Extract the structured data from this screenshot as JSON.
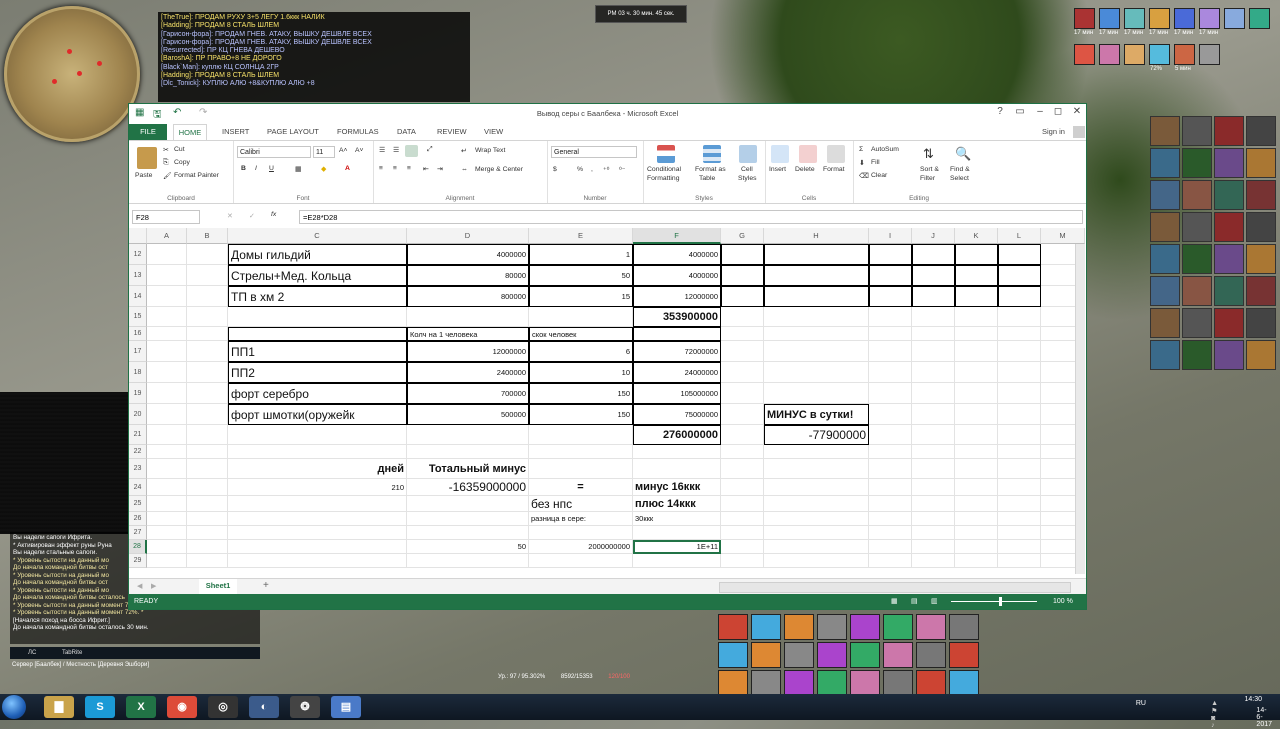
{
  "game": {
    "chat_top": [
      {
        "text": "[TheTrue]: ПРОДАМ РУХУ 3+5 ЛЕГУ 1.6ккк НАЛИК",
        "hl": true
      },
      {
        "text": "[Hadding]: ПРОДАМ 8 СТАЛЬ ШЛЕМ",
        "hl": true
      },
      {
        "text": "[Гарисон-фора]: ПРОДАМ ГНЕВ. АТАКУ, ВЫШКУ ДЕШВЛЕ ВСЕХ",
        "hl": false
      },
      {
        "text": "[Гарисон-фора]: ПРОДАМ ГНЕВ. АТАКУ, ВЫШКУ ДЕШВЛЕ ВСЕХ",
        "hl": false
      },
      {
        "text": "[Resurrected]: ПР КЦ ГНЕВА ДЕШЕВО",
        "hl": false
      },
      {
        "text": "[BaroshA]: ПР ПРАВО+8 НЕ ДОРОГО",
        "hl": true
      },
      {
        "text": "[Black`Man]: куплю КЦ СОЛНЦА 2ГР",
        "hl": false
      },
      {
        "text": "[Hadding]: ПРОДАМ 8 СТАЛЬ ШЛЕМ",
        "hl": true
      },
      {
        "text": "[Dlc_Tonick]: КУПЛЮ АЛЮ +8&КУПЛЮ АЛЮ +8",
        "hl": false
      }
    ],
    "timer": "PM 03 ч. 30 мин. 45 сек.",
    "buff_times": [
      "17 мин",
      "17 мин",
      "17 мин",
      "17 мин",
      "17 мин",
      "17 мин",
      "72%",
      "5 мин"
    ],
    "chat_bottom": [
      {
        "text": "Вы надели сапоги Ифрита.",
        "w": true
      },
      {
        "text": "  * Активирован эффект руны Руна",
        "w": true
      },
      {
        "text": "Вы надели стальные сапоги.",
        "w": true
      },
      {
        "text": "  * Уровень сытости на данный мо",
        "w": false
      },
      {
        "text": "До начала командной битвы ост",
        "w": false
      },
      {
        "text": "  * Уровень сытости на данный мо",
        "w": false
      },
      {
        "text": "До начала командной битвы ост",
        "w": false
      },
      {
        "text": "  * Уровень сытости на данный мо",
        "w": false
      },
      {
        "text": "До начала командной битвы осталось",
        "w": false
      },
      {
        "text": "  * Уровень сытости на данный момент 72%. *",
        "w": false
      },
      {
        "text": "  * Уровень сытости на данный момент 72%. *",
        "w": false
      },
      {
        "text": "[Начался поход на босса Ифрит.]",
        "w": true
      },
      {
        "text": "До начала командной битвы осталось 30 мин.",
        "w": true
      }
    ],
    "chat_tabs": [
      "ЛС",
      "TabRite"
    ],
    "server_line": "Сервер [Баалбек] / Местность [Деревня Эшбори]",
    "xp_text": "Ур.: 97 / 95.302%",
    "xp_text2": "8592/15353",
    "hp_text": "120/100"
  },
  "excel": {
    "title": "Вывод серы с Баалбека - Microsoft Excel",
    "sign_in": "Sign in",
    "window_controls": [
      "?",
      "▭",
      "–",
      "◻",
      "✕"
    ],
    "tabs": [
      "FILE",
      "HOME",
      "INSERT",
      "PAGE LAYOUT",
      "FORMULAS",
      "DATA",
      "REVIEW",
      "VIEW"
    ],
    "ribbon": {
      "paste": "Paste",
      "cut": "Cut",
      "copy": "Copy",
      "format_painter": "Format Painter",
      "clipboard": "Clipboard",
      "font_name": "Calibri",
      "font_size": "11",
      "font": "Font",
      "bold": "B",
      "italic": "I",
      "underline": "U",
      "wrap_text": "Wrap Text",
      "merge_center": "Merge & Center",
      "alignment": "Alignment",
      "number_format": "General",
      "percent": "%",
      "comma": ",",
      "number": "Number",
      "conditional": "Conditional",
      "formatting": "Formatting",
      "format_as": "Format as",
      "table": "Table",
      "cell": "Cell",
      "styles_btn": "Styles",
      "styles": "Styles",
      "insert": "Insert",
      "delete": "Delete",
      "format": "Format",
      "cells": "Cells",
      "autosum": "AutoSum",
      "fill": "Fill",
      "clear": "Clear",
      "sort_filter": "Sort &",
      "filter": "Filter",
      "find_select": "Find &",
      "select": "Select",
      "editing": "Editing"
    },
    "name_box": "F28",
    "formula": "=E28*D28",
    "columns": [
      "A",
      "B",
      "C",
      "D",
      "E",
      "F",
      "G",
      "H",
      "I",
      "J",
      "K",
      "L",
      "M"
    ],
    "rows": [
      {
        "n": "12",
        "cells": {
          "C": "Домы гильдий",
          "D": "4000000",
          "E": "1",
          "F": "4000000"
        }
      },
      {
        "n": "13",
        "cells": {
          "C": "Стрелы+Мед. Кольца",
          "D": "80000",
          "E": "50",
          "F": "4000000"
        }
      },
      {
        "n": "14",
        "cells": {
          "C": "ТП в хм 2",
          "D": "800000",
          "E": "15",
          "F": "12000000"
        }
      },
      {
        "n": "15",
        "cells": {
          "F": "353900000"
        }
      },
      {
        "n": "16",
        "cells": {
          "D": "Колч на 1 человека",
          "E": "скок человек"
        }
      },
      {
        "n": "17",
        "cells": {
          "C": "ПП1",
          "D": "12000000",
          "E": "6",
          "F": "72000000"
        }
      },
      {
        "n": "18",
        "cells": {
          "C": "ПП2",
          "D": "2400000",
          "E": "10",
          "F": "24000000"
        }
      },
      {
        "n": "19",
        "cells": {
          "C": "форт серебро",
          "D": "700000",
          "E": "150",
          "F": "105000000"
        }
      },
      {
        "n": "20",
        "cells": {
          "C": "форт шмотки(оружейк",
          "D": "500000",
          "E": "150",
          "F": "75000000",
          "H": "МИНУС в сутки!"
        }
      },
      {
        "n": "21",
        "cells": {
          "F": "276000000",
          "H": "-77900000"
        }
      },
      {
        "n": "22",
        "cells": {}
      },
      {
        "n": "23",
        "cells": {
          "C": "дней",
          "D": "Тотальный минус"
        }
      },
      {
        "n": "24",
        "cells": {
          "C": "210",
          "D": "-16359000000",
          "E": "=",
          "F": "минус 16ккк"
        }
      },
      {
        "n": "25",
        "cells": {
          "E": "без нпс",
          "F": "плюс 14ккк"
        }
      },
      {
        "n": "26",
        "cells": {
          "E": "разница в сере:",
          "F": "30ккк"
        }
      },
      {
        "n": "27",
        "cells": {}
      },
      {
        "n": "28",
        "cells": {
          "D": "50",
          "E": "2000000000",
          "F": "1E+11"
        }
      },
      {
        "n": "29",
        "cells": {}
      }
    ],
    "sheet_tab": "Sheet1",
    "add_sheet": "+",
    "status": "READY",
    "zoom": "100 %"
  },
  "taskbar": {
    "apps": [
      "Explorer",
      "Skype",
      "Excel",
      "Chrome",
      "OBS",
      "Browser",
      "Game",
      "Notes"
    ],
    "lang": "RU",
    "time": "14:30",
    "date": "14-6-2017"
  }
}
